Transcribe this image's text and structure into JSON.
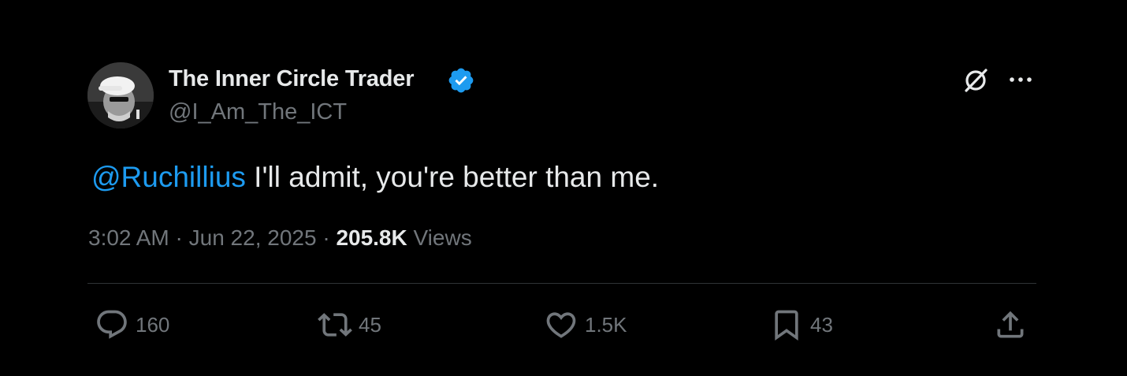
{
  "author": {
    "name": "The Inner Circle Trader",
    "handle": "@I_Am_The_ICT",
    "verified_color": "#1d9bf0"
  },
  "tweet": {
    "mention": "@Ruchillius",
    "text": " I'll admit, you're better than me."
  },
  "meta": {
    "time": "3:02 AM",
    "separator1": " · ",
    "date": "Jun 22, 2025",
    "separator2": " · ",
    "views_count": "205.8K",
    "views_label": " Views"
  },
  "actions": {
    "replies": "160",
    "reposts": "45",
    "likes": "1.5K",
    "bookmarks": "43"
  },
  "icons": {
    "reply": "reply-icon",
    "repost": "repost-icon",
    "like": "heart-icon",
    "bookmark": "bookmark-icon",
    "share": "share-icon",
    "grok": "grok-icon",
    "more": "more-icon",
    "verified": "verified-badge-icon"
  },
  "colors": {
    "background": "#000000",
    "text": "#e7e9ea",
    "muted": "#71767b",
    "accent": "#1d9bf0",
    "divider": "#2f3336"
  }
}
